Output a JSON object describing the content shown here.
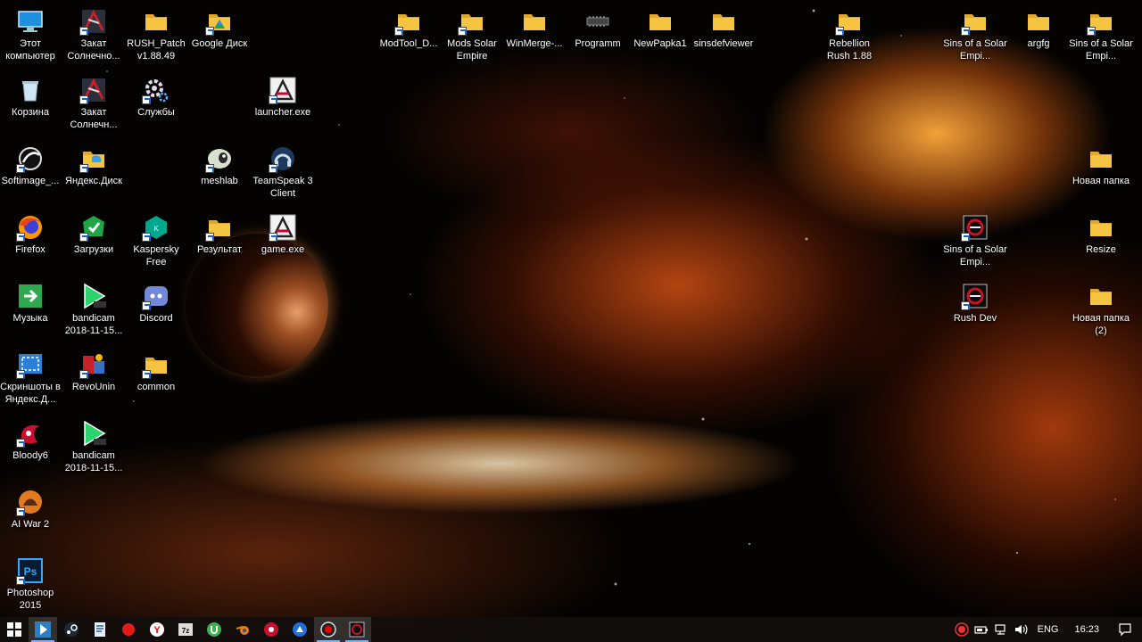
{
  "desktop": {
    "icons": {
      "this_pc": "Этот компьютер",
      "eclipse1": "Закат Солнечно...",
      "rush_patch": "RUSH_Patch v1.88.49",
      "google_disk": "Google Диск",
      "modtool": "ModTool_D...",
      "mods_solar": "Mods Solar Empire",
      "winmerge": "WinMerge-...",
      "programm": "Programm",
      "newpapka1": "NewPapka1",
      "sinsdefviewer": "sinsdefviewer",
      "rebellion": "Rebellion Rush 1.88",
      "sins1": "Sins of a Solar Empi...",
      "argfg": "argfg",
      "sins2": "Sins of a Solar Empi...",
      "recycle": "Корзина",
      "eclipse2": "Закат Солнечн...",
      "services": "Службы",
      "launcher": "launcher.exe",
      "softimage": "Softimage_...",
      "yandex_disk": "Яндекс.Диск",
      "meshlab": "meshlab",
      "teamspeak": "TeamSpeak 3 Client",
      "new_folder": "Новая папка",
      "firefox": "Firefox",
      "downloads": "Загрузки",
      "kaspersky": "Kaspersky Free",
      "result": "Результат",
      "game": "game.exe",
      "sins3": "Sins of a Solar Empi...",
      "resize": "Resize",
      "music": "Музыка",
      "bandicam1": "bandicam 2018-11-15...",
      "discord": "Discord",
      "rush_dev": "Rush Dev",
      "new_folder2": "Новая папка (2)",
      "screenshots": "Скриншоты в Яндекс.Д...",
      "revo": "RevoUnin",
      "common": "common",
      "bloody": "Bloody6",
      "bandicam2": "bandicam 2018-11-15...",
      "aiwar": "AI War 2",
      "photoshop": "Photoshop 2015"
    }
  },
  "taskbar": {
    "language": "ENG",
    "time": "16:23"
  },
  "colors": {
    "folder": "#f5c542",
    "taskbar_bg": "#120e0c",
    "accent": "#7fb0ff"
  }
}
